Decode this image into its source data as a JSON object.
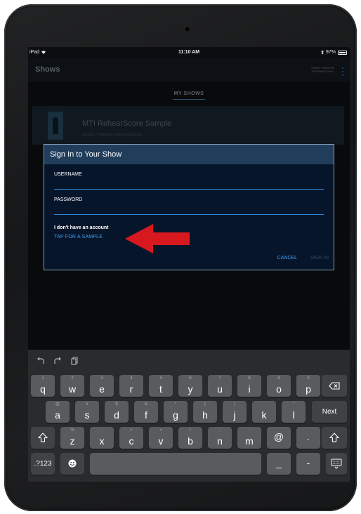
{
  "status_bar": {
    "device": "iPad",
    "time": "11:10 AM",
    "battery": "97%",
    "battery_level": 0.97
  },
  "app": {
    "title": "Shows",
    "brand_line1": "MUSIC THEATRE",
    "brand_line2": "INTERNATIONAL",
    "tab": "MY SHOWS"
  },
  "show_card": {
    "title": "MTI RehearScore Sample",
    "subtitle": "Music Theatre International"
  },
  "dialog": {
    "title": "Sign In to Your Show",
    "username_label": "USERNAME",
    "username_value": "",
    "password_label": "PASSWORD",
    "password_value": "",
    "no_account": "I don't have an account",
    "sample_link": "TAP FOR A SAMPLE",
    "cancel": "CANCEL",
    "sign_in": "SIGN IN"
  },
  "annotation": {
    "arrow_color": "#d7191f"
  },
  "keyboard": {
    "row1": [
      {
        "k": "q",
        "a": "1"
      },
      {
        "k": "w",
        "a": "2"
      },
      {
        "k": "e",
        "a": "3"
      },
      {
        "k": "r",
        "a": "4"
      },
      {
        "k": "t",
        "a": "5"
      },
      {
        "k": "y",
        "a": "6"
      },
      {
        "k": "u",
        "a": "7"
      },
      {
        "k": "i",
        "a": "8"
      },
      {
        "k": "o",
        "a": "9"
      },
      {
        "k": "p",
        "a": "0"
      }
    ],
    "row2": [
      {
        "k": "a",
        "a": "@"
      },
      {
        "k": "s",
        "a": "#"
      },
      {
        "k": "d",
        "a": "$"
      },
      {
        "k": "f",
        "a": "&"
      },
      {
        "k": "g",
        "a": "*"
      },
      {
        "k": "h",
        "a": "("
      },
      {
        "k": "j",
        "a": ")"
      },
      {
        "k": "k",
        "a": "'"
      },
      {
        "k": "l",
        "a": "\""
      }
    ],
    "row3": [
      {
        "k": "z",
        "a": "%"
      },
      {
        "k": "x",
        "a": "-"
      },
      {
        "k": "c",
        "a": "+"
      },
      {
        "k": "v",
        "a": "="
      },
      {
        "k": "b",
        "a": "/"
      },
      {
        "k": "n",
        "a": ";"
      },
      {
        "k": "m",
        "a": ":"
      }
    ],
    "at_key": "@",
    "dot_key": ".",
    "next": "Next",
    "numbers": ".?123",
    "underscore": "_",
    "dash": "-",
    "icons": {
      "undo": "undo-icon",
      "redo": "redo-icon",
      "paste": "paste-icon",
      "backspace": "backspace-icon",
      "shift": "shift-icon",
      "emoji": "emoji-icon",
      "hide": "keyboard-hide-icon"
    }
  }
}
